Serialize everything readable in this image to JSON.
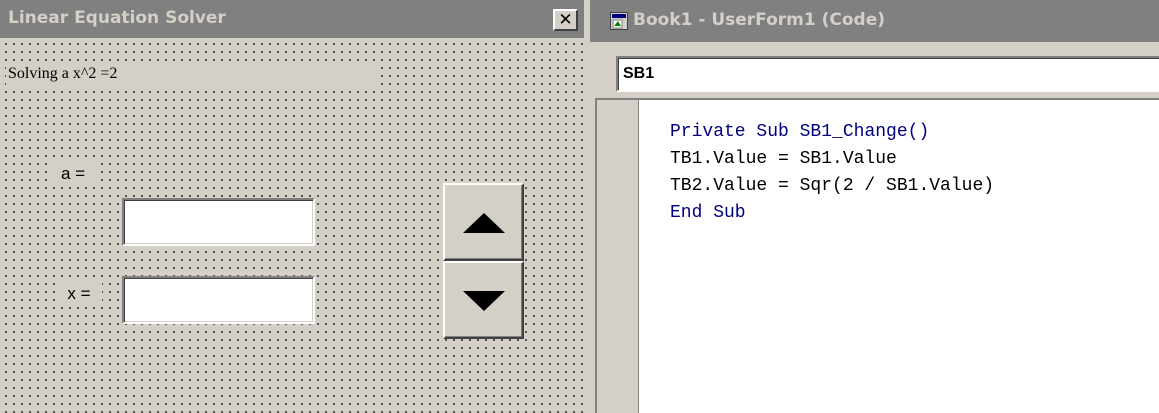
{
  "form": {
    "title": "Linear Equation Solver",
    "close_glyph": "✕",
    "heading": "Solving a x^2 =2",
    "label_a": "a =",
    "label_x": "x =",
    "textbox_a": "",
    "textbox_x": "",
    "spin_up_icon": "triangle-up-icon",
    "spin_down_icon": "triangle-down-icon"
  },
  "code_window": {
    "title": "Book1 - UserForm1 (Code)",
    "object_selector": "SB1",
    "lines": [
      {
        "kw1": "Private Sub",
        "rest": " SB1_Change()"
      },
      {
        "rest": "TB1.Value = SB1.Value"
      },
      {
        "rest": "TB2.Value = Sqr(2 / SB1.Value)"
      },
      {
        "kw1": "End Sub",
        "rest": ""
      }
    ]
  },
  "colors": {
    "inactive_titlebar": "#808080",
    "face": "#d4d0c8",
    "keyword": "#00007f"
  }
}
